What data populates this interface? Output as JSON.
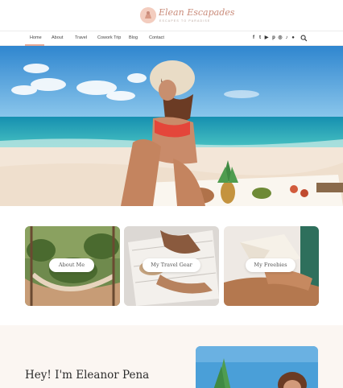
{
  "brand": {
    "name": "Elean Escapades",
    "tagline": "ESCAPES TO PARADISE"
  },
  "nav": {
    "items": [
      {
        "label": "Home",
        "active": true
      },
      {
        "label": "About"
      },
      {
        "label": "Travel"
      },
      {
        "label": "Cowork Trip"
      },
      {
        "label": "Blog"
      },
      {
        "label": "Contact"
      }
    ],
    "social_icons": [
      "facebook-icon",
      "twitter-icon",
      "youtube-icon",
      "pinterest-icon",
      "instagram-icon",
      "tiktok-icon",
      "spotify-icon"
    ],
    "social_glyphs": [
      "f",
      "t",
      "▶",
      "p",
      "◎",
      "♪",
      "●"
    ]
  },
  "cards": [
    {
      "label": "About Me"
    },
    {
      "label": "My Travel Gear"
    },
    {
      "label": "My Freebies"
    }
  ],
  "intro": {
    "heading": "Hey! I'm Eleanor Pena"
  },
  "colors": {
    "accent": "#e7a995",
    "intro_bg": "#fbf6f2",
    "sky": "#4a9fd8",
    "sea": "#1fa8b8"
  }
}
